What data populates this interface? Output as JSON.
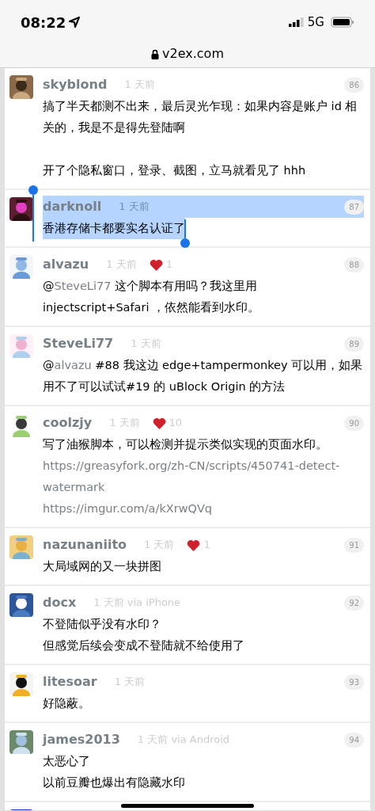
{
  "status_bar": {
    "time": "08:22",
    "network": "5G"
  },
  "address_bar": {
    "url": "v2ex.com"
  },
  "replies": [
    {
      "user": "skyblond",
      "time": "1 天前",
      "floor": "86",
      "text_selected": false,
      "content": [
        {
          "kind": "text",
          "parts": [
            {
              "text": "搞了半天都测不出来，最后灵光乍现：如果内容是账户 id 相关的，我是不是得先登陆啊"
            }
          ]
        },
        {
          "kind": "break"
        },
        {
          "kind": "text",
          "parts": [
            {
              "text": "开了个隐私窗口，登录、截图，立马就看见了 hhh"
            }
          ]
        }
      ]
    },
    {
      "user": "darknoll",
      "time": "1 天前",
      "floor": "87",
      "text_selected": true,
      "content": [
        {
          "kind": "text",
          "parts": [
            {
              "text": "香港存储卡都要实名认证了"
            }
          ]
        }
      ]
    },
    {
      "user": "alvazu",
      "time": "1 天前",
      "likes": "1",
      "floor": "88",
      "text_selected": false,
      "content": [
        {
          "kind": "text",
          "parts": [
            {
              "kind": "plain",
              "text": "@"
            },
            {
              "kind": "mention",
              "text": "SteveLi77"
            },
            {
              "kind": "plain",
              "text": " 这个脚本有用吗？我这里用 injectscript+Safari ，依然能看到水印。"
            }
          ]
        }
      ]
    },
    {
      "user": "SteveLi77",
      "time": "1 天前",
      "floor": "89",
      "text_selected": false,
      "content": [
        {
          "kind": "text",
          "parts": [
            {
              "kind": "plain",
              "text": "@"
            },
            {
              "kind": "mention",
              "text": "alvazu"
            },
            {
              "kind": "plain",
              "text": " #88 我这边 edge+tampermonkey 可以用，如果用不了可以试试#19 的 uBlock Origin 的方法"
            }
          ]
        }
      ]
    },
    {
      "user": "coolzjy",
      "time": "1 天前",
      "likes": "10",
      "floor": "90",
      "text_selected": false,
      "content": [
        {
          "kind": "text",
          "parts": [
            {
              "text": "写了油猴脚本，可以检测并提示类似实现的页面水印。"
            }
          ]
        },
        {
          "kind": "link",
          "text": "https://greasyfork.org/zh-CN/scripts/450741-detect-watermark"
        },
        {
          "kind": "link",
          "text": "https://imgur.com/a/kXrwQVq"
        }
      ]
    },
    {
      "user": "nazunaniito",
      "time": "1 天前",
      "likes": "1",
      "floor": "91",
      "text_selected": false,
      "content": [
        {
          "kind": "text",
          "parts": [
            {
              "text": "大局域网的又一块拼图"
            }
          ]
        }
      ]
    },
    {
      "user": "docx",
      "time": "1 天前 via iPhone",
      "floor": "92",
      "text_selected": false,
      "content": [
        {
          "kind": "text",
          "parts": [
            {
              "text": "不登陆似乎没有水印？"
            }
          ]
        },
        {
          "kind": "text",
          "parts": [
            {
              "text": "但感觉后续会变成不登陆就不给使用了"
            }
          ]
        }
      ]
    },
    {
      "user": "litesoar",
      "time": "1 天前",
      "floor": "93",
      "text_selected": false,
      "content": [
        {
          "kind": "text",
          "parts": [
            {
              "text": "好隐蔽。"
            }
          ]
        }
      ]
    },
    {
      "user": "james2013",
      "time": "1 天前 via Android",
      "floor": "94",
      "text_selected": false,
      "content": [
        {
          "kind": "text",
          "parts": [
            {
              "text": "太恶心了"
            }
          ]
        },
        {
          "kind": "text",
          "parts": [
            {
              "text": "以前豆瓣也爆出有隐藏水印"
            }
          ]
        }
      ]
    }
  ]
}
